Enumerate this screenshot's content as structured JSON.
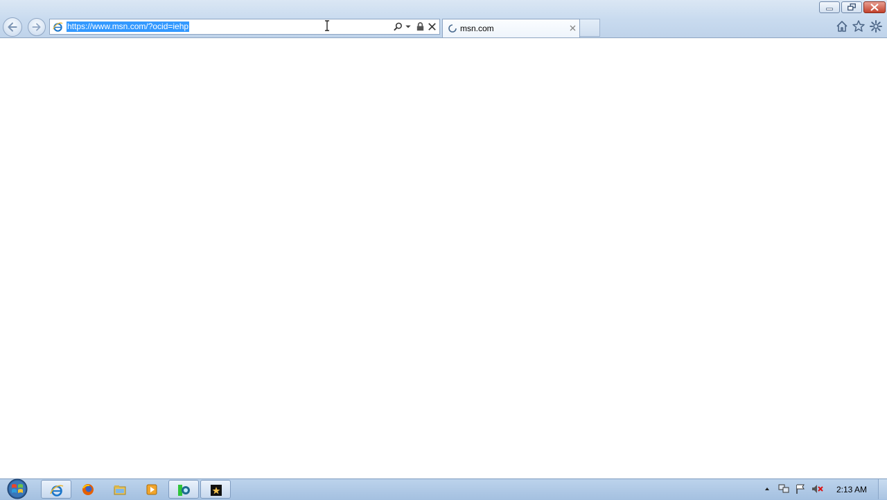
{
  "window": {
    "controls": [
      "minimize",
      "restore",
      "close"
    ]
  },
  "navigation": {
    "back_icon": "back-arrow-icon",
    "forward_icon": "forward-arrow-icon"
  },
  "address_bar": {
    "url": "https://www.msn.com/?ocid=iehp",
    "selected": true,
    "icons": [
      "ie-favicon-icon",
      "search-icon",
      "dropdown-icon",
      "lock-icon",
      "stop-icon"
    ]
  },
  "tabs": [
    {
      "label": "msn.com",
      "loading": true,
      "icon": "loading-spinner-icon"
    }
  ],
  "toolbar": {
    "icons": [
      "home-icon",
      "favorites-star-icon",
      "tools-gear-icon"
    ]
  },
  "taskbar": {
    "pinned": [
      "internet-explorer-icon",
      "firefox-icon",
      "file-explorer-icon",
      "media-player-icon",
      "app-green-icon",
      "video-app-icon"
    ],
    "tray_icons": [
      "show-hidden-icons-icon",
      "network-icon",
      "action-center-flag-icon",
      "volume-muted-icon"
    ],
    "clock": "2:13 AM"
  },
  "colors": {
    "selection": "#3399ff",
    "frame": "#c9dbef",
    "taskbar": "#b3cbe7"
  }
}
